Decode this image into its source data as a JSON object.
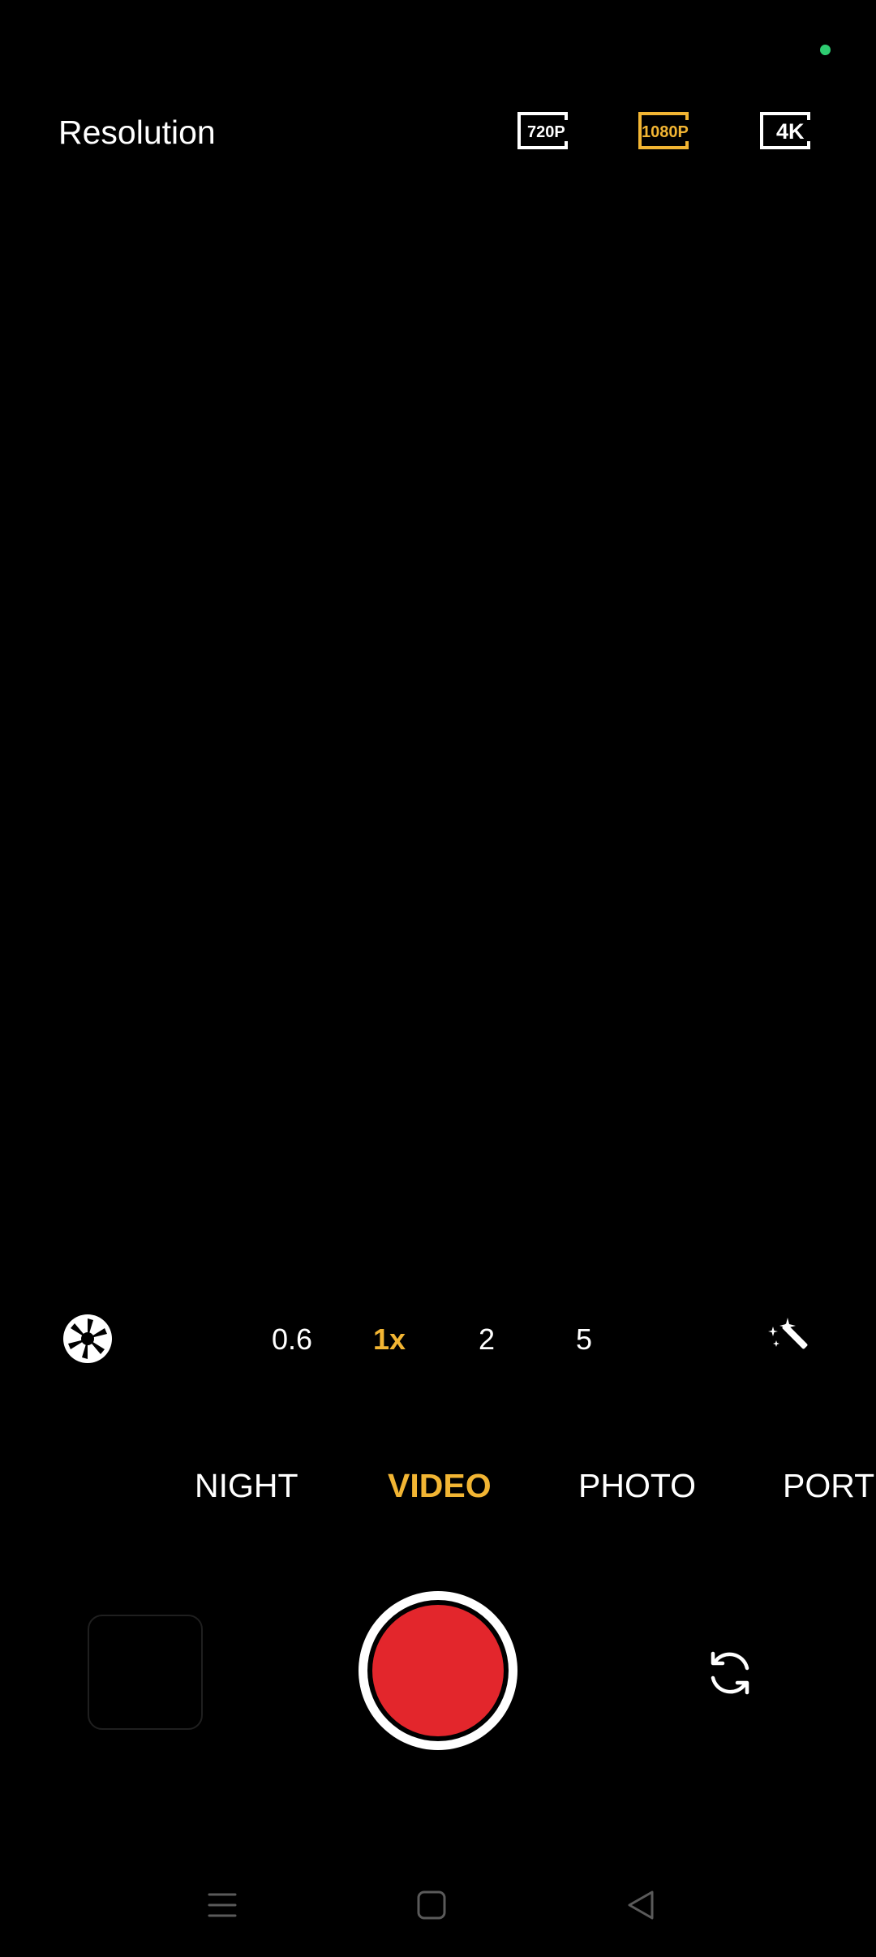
{
  "status": {
    "indicator_color": "#2ecc71"
  },
  "resolution_bar": {
    "title": "Resolution",
    "options": [
      {
        "label": "720P",
        "selected": false
      },
      {
        "label": "1080P",
        "selected": true
      },
      {
        "label": "4K",
        "selected": false
      }
    ]
  },
  "zoom": {
    "left_icon": "aperture-icon",
    "levels": [
      {
        "label": "0.6",
        "active": false
      },
      {
        "label": "1x",
        "active": true
      },
      {
        "label": "2",
        "active": false
      },
      {
        "label": "5",
        "active": false
      }
    ],
    "right_icon": "magic-wand-icon"
  },
  "modes": [
    {
      "label": "NIGHT",
      "active": false
    },
    {
      "label": "VIDEO",
      "active": true
    },
    {
      "label": "PHOTO",
      "active": false
    },
    {
      "label": "PORTRAIT",
      "active": false
    }
  ],
  "controls": {
    "gallery_icon": "gallery-thumbnail",
    "shutter_icon": "record-button",
    "flip_icon": "flip-camera-icon"
  },
  "navigation": {
    "items": [
      "menu-icon",
      "home-icon",
      "back-icon"
    ]
  },
  "colors": {
    "accent": "#f2b533",
    "text": "#ffffff",
    "record": "#e3262c",
    "background": "#000000",
    "nav_icon": "#5a5a5a"
  }
}
